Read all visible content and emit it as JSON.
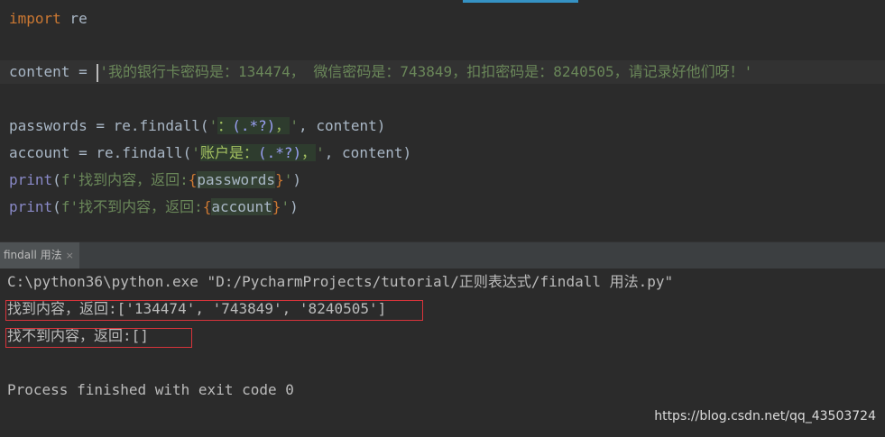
{
  "editor": {
    "line1": {
      "keyword": "import",
      "rest": " re"
    },
    "line2": {
      "lhs": "content = ",
      "string": "'我的银行卡密码是：134474， 微信密码是：743849，扣扣密码是：8240505，请记录好他们呀！'"
    },
    "line3": {
      "lhs": "passwords = re.findall(",
      "str_open": "'",
      "rx_a": "：",
      "rx_meta": "(.*?)",
      "rx_b": "，",
      "str_close": "'",
      "tail": ", content)"
    },
    "line4": {
      "lhs": "account = re.findall(",
      "str_open": "'",
      "rx_a": "账户是：",
      "rx_meta": "(.*?)",
      "rx_b": "，",
      "str_close": "'",
      "tail": ", content)"
    },
    "line5": {
      "fn": "print",
      "open": "(",
      "fstr_a": "f'找到内容，返回:",
      "brace_open": "{",
      "var": "passwords",
      "brace_close": "}",
      "fstr_b": "'",
      "close": ")"
    },
    "line6": {
      "fn": "print",
      "open": "(",
      "fstr_a": "f'找不到内容，返回:",
      "brace_open": "{",
      "var": "account",
      "brace_close": "}",
      "fstr_b": "'",
      "close": ")"
    }
  },
  "run_panel": {
    "tab_label": "findall 用法",
    "close_glyph": "×"
  },
  "console": {
    "command": "C:\\python36\\python.exe \"D:/PycharmProjects/tutorial/正则表达式/findall 用法.py\"",
    "output1": "找到内容，返回:['134474', '743849', '8240505']",
    "output2": "找不到内容，返回:[]",
    "exit_message": "Process finished with exit code 0"
  },
  "watermark": "https://blog.csdn.net/qq_43503724",
  "colors": {
    "editor_bg": "#2b2b2b",
    "keyword": "#cc7832",
    "string": "#6a8759",
    "builtin": "#8888c6",
    "highlight_box": "#d7343b"
  }
}
